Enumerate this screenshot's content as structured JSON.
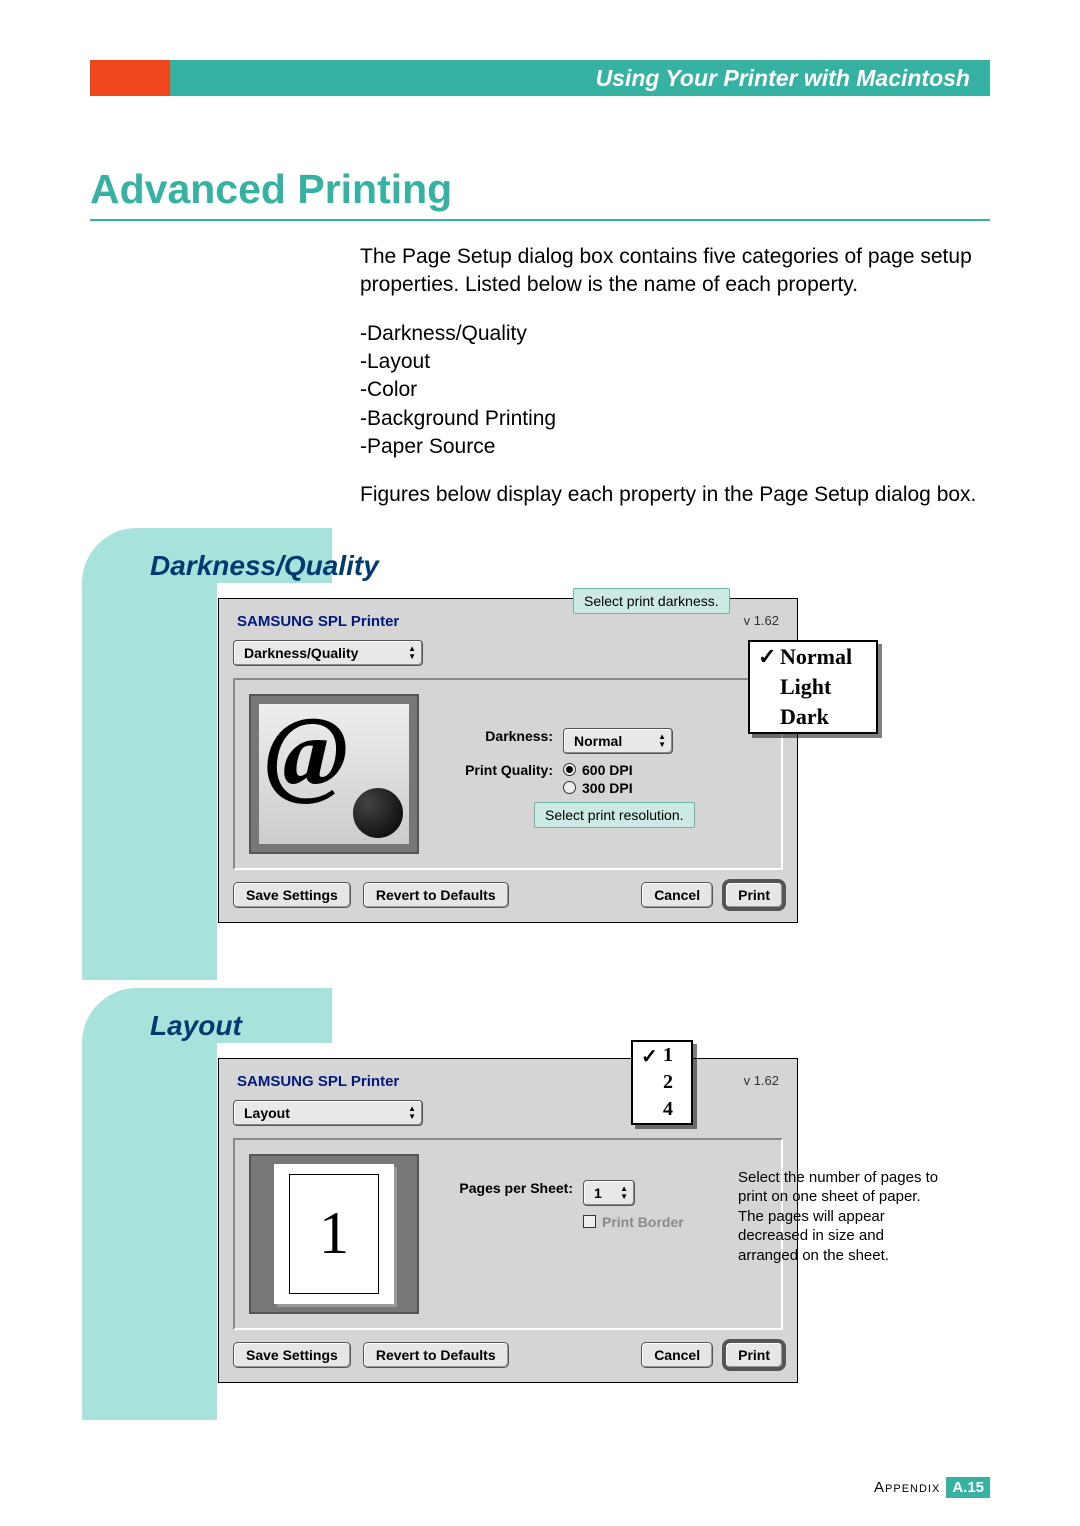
{
  "header": {
    "title": "Using Your Printer with Macintosh"
  },
  "page_title": "Advanced Printing",
  "intro": {
    "p1": "The Page Setup dialog box contains five categories of page setup properties. Listed below is the name of each property.",
    "items": [
      "-Darkness/Quality",
      "-Layout",
      "-Color",
      "-Background Printing",
      "-Paper Source"
    ],
    "p2": "Figures below display each property in the Page Setup dialog box."
  },
  "section1": {
    "heading": "Darkness/Quality",
    "dialog": {
      "title": "SAMSUNG SPL Printer",
      "version": "v 1.62",
      "tab": "Darkness/Quality",
      "darkness_label": "Darkness:",
      "darkness_value": "Normal",
      "quality_label": "Print Quality:",
      "quality_options": [
        "600 DPI",
        "300 DPI"
      ],
      "quality_selected": "600 DPI",
      "buttons": {
        "save": "Save Settings",
        "revert": "Revert to Defaults",
        "cancel": "Cancel",
        "print": "Print"
      }
    },
    "callout1": "Select print darkness.",
    "callout2": "Select print resolution.",
    "dropdown": {
      "items": [
        "Normal",
        "Light",
        "Dark"
      ],
      "selected": "Normal"
    }
  },
  "section2": {
    "heading": "Layout",
    "dialog": {
      "title": "SAMSUNG SPL Printer",
      "version": "v 1.62",
      "tab": "Layout",
      "pps_label": "Pages per Sheet:",
      "pps_value": "1",
      "border_label": "Print Border",
      "preview_number": "1",
      "buttons": {
        "save": "Save Settings",
        "revert": "Revert to Defaults",
        "cancel": "Cancel",
        "print": "Print"
      }
    },
    "dropdown": {
      "items": [
        "1",
        "2",
        "4"
      ],
      "selected": "1"
    },
    "side_note": "Select the number of pages to print on one sheet of paper. The pages will appear decreased in size and arranged on the sheet."
  },
  "footer": {
    "appendix": "Appendix",
    "prefix": "A.",
    "page": "15"
  }
}
